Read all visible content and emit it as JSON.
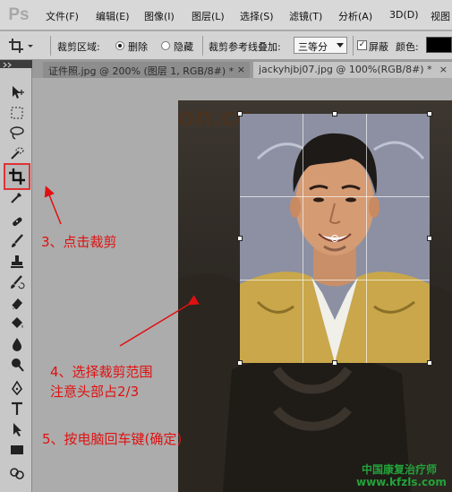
{
  "app": {
    "logo": "Ps"
  },
  "menu": [
    "文件(F)",
    "编辑(E)",
    "图像(I)",
    "图层(L)",
    "选择(S)",
    "滤镜(T)",
    "分析(A)",
    "3D(D)",
    "视图"
  ],
  "options": {
    "crop_area_label": "裁剪区域:",
    "delete_label": "删除",
    "hide_label": "隐藏",
    "overlay_label": "裁剪参考线叠加:",
    "overlay_value": "三等分",
    "shield_label": "屏蔽",
    "color_label": "颜色:",
    "shield_color": "#000000"
  },
  "tabs": [
    {
      "label": "证件照.jpg @ 200% (图层 1, RGB/8#) *",
      "close": "×"
    },
    {
      "label": "jackyhjbj07.jpg @ 100%(RGB/8#) *",
      "close": "×"
    }
  ],
  "tools": [
    "move-tool",
    "rect-marquee-tool",
    "lasso-tool",
    "quick-select-tool",
    "crop-tool",
    "eyedropper-tool",
    "healing-brush-tool",
    "brush-tool",
    "clone-stamp-tool",
    "history-brush-tool",
    "eraser-tool",
    "paint-bucket-tool",
    "blur-tool",
    "dodge-tool",
    "pen-tool",
    "type-tool",
    "path-select-tool",
    "rectangle-tool",
    "zoom-tool"
  ],
  "canvas": {
    "bg_text": "on.cc"
  },
  "annotations": {
    "step3": "3、点击裁剪",
    "step4_line1": "4、选择裁剪范围",
    "step4_line2": "注意头部占2/3",
    "step5": "5、按电脑回车键(确定)"
  },
  "watermark": {
    "line1": "中国康复治疗师",
    "line2": "www.kfzls.com"
  },
  "colors": {
    "annotation_red": "#e01010",
    "watermark_green": "#23a23a"
  }
}
